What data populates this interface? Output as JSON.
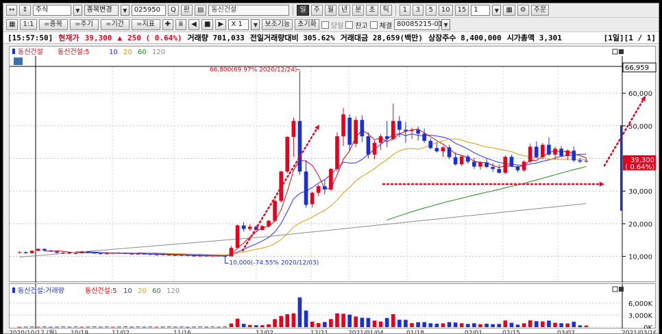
{
  "toolbar": {
    "market_type": "주식",
    "stock_change_label": "종목변경",
    "stock_code": "025950",
    "search_button": "Q",
    "pan_button": "판",
    "stock_name": "동신건설",
    "periods": [
      "일",
      "주",
      "월",
      "년",
      "분",
      "초",
      "틱"
    ],
    "selected_period": "일",
    "intervals": [
      "1",
      "3",
      "5",
      "10",
      "15"
    ],
    "interval_value": "1",
    "order_label": "주문",
    "sub_buttons": [
      "=종목",
      "=주기",
      "=기간",
      "=지표"
    ],
    "multiplier": "X 1",
    "aux_label": "보조기능",
    "reset_label": "초기화",
    "today_label": "당일",
    "balance_label": "잔고",
    "fill_label": "체결",
    "account": "80085215-01"
  },
  "status": {
    "time": "[15:57:50]",
    "current_label": "현재가",
    "price": "39,300",
    "arrow": "▲",
    "change": "250 ( 0.64%)",
    "volume": "거래량 701,033",
    "prev_volume_ratio": "전일거래량대비 305.62%",
    "trade_value": "거래대금 28,659(백만)",
    "shares": "상장주수 8,400,000",
    "market_cap": "시가총액 3,301",
    "page": "[1일][1 / 1]"
  },
  "price_legend": {
    "name": "동신건설",
    "ma_label": "동신건설:5",
    "ma_periods": [
      "10",
      "20",
      "60",
      "120"
    ]
  },
  "volume_legend": {
    "vol_label": "동신건설:거래량",
    "ma_label": "동신건설:5",
    "ma_periods": [
      "10",
      "20",
      "60",
      "120"
    ]
  },
  "annotations": {
    "high": "66,800(69.97% 2020/12/24)",
    "low": "10,000(-74.55% 2020/12/03)",
    "top_value": "66,959",
    "cur_price": "39,300",
    "cur_change": "( 0.64%)"
  },
  "y_ticks": [
    "60,000",
    "50,000",
    "40,000",
    "30,000",
    "20,000",
    "10,000"
  ],
  "vol_ticks": [
    "6,000K",
    "3,000K",
    "0K"
  ],
  "x_ticks": [
    "2020/10/12 (월)",
    "10/19",
    "11/02",
    "11/16",
    "12/02",
    "12/21",
    "2021/01/04",
    "01/18",
    "02/01",
    "02/15",
    "03/02",
    "2021/03/16"
  ],
  "colors": {
    "up": "#e8001c",
    "down": "#1c2fd6",
    "ma5": "#e00000",
    "ma10": "#2a2aff",
    "ma20": "#e89a00",
    "ma60": "#1a8a1a",
    "ma120": "#8a8a8a"
  },
  "chart_data": {
    "type": "candlestick",
    "ylim": [
      3000,
      68000
    ],
    "series": [
      {
        "name": "동신건설",
        "ohlc": [
          [
            11200,
            11600,
            10900,
            11300
          ],
          [
            11300,
            11500,
            10800,
            11000
          ],
          [
            11000,
            11800,
            10900,
            11700
          ],
          [
            11700,
            12500,
            11600,
            12300
          ],
          [
            12300,
            12400,
            11500,
            11800
          ],
          [
            11800,
            12000,
            11300,
            11500
          ],
          [
            11500,
            11600,
            10900,
            11100
          ],
          [
            11100,
            11400,
            10800,
            11200
          ],
          [
            11200,
            11300,
            10700,
            10900
          ],
          [
            10900,
            11200,
            10700,
            11000
          ],
          [
            11000,
            11700,
            10900,
            11500
          ],
          [
            11500,
            11600,
            11000,
            11100
          ],
          [
            11100,
            11300,
            10800,
            10900
          ],
          [
            10900,
            11100,
            10600,
            10800
          ],
          [
            10800,
            11000,
            10600,
            10900
          ],
          [
            10900,
            11200,
            10700,
            11100
          ],
          [
            11100,
            11300,
            10900,
            11000
          ],
          [
            11000,
            11100,
            10700,
            10800
          ],
          [
            10800,
            10900,
            10500,
            10700
          ],
          [
            10700,
            10900,
            10500,
            10800
          ],
          [
            10800,
            11000,
            10600,
            10700
          ],
          [
            10700,
            10800,
            10400,
            10500
          ],
          [
            10500,
            10700,
            10300,
            10600
          ],
          [
            10600,
            10800,
            10400,
            10500
          ],
          [
            10500,
            10600,
            10200,
            10400
          ],
          [
            10400,
            10600,
            10100,
            10300
          ],
          [
            10300,
            10500,
            10100,
            10400
          ],
          [
            10400,
            10500,
            10000,
            10200
          ],
          [
            10200,
            10300,
            10000,
            10100
          ],
          [
            10100,
            10300,
            10000,
            10200
          ],
          [
            10200,
            10400,
            10000,
            10100
          ],
          [
            10100,
            10300,
            10000,
            10200
          ],
          [
            10200,
            10300,
            10000,
            10100
          ],
          [
            10100,
            10200,
            10000,
            10050
          ],
          [
            10000,
            13200,
            10000,
            12600
          ],
          [
            12600,
            19800,
            12400,
            19500
          ],
          [
            19500,
            20500,
            17600,
            18400
          ],
          [
            18400,
            19800,
            17900,
            19100
          ],
          [
            19100,
            19500,
            17800,
            18100
          ],
          [
            18100,
            19600,
            17900,
            19300
          ],
          [
            19300,
            21200,
            18800,
            20900
          ],
          [
            20900,
            27500,
            20500,
            27000
          ],
          [
            27000,
            36200,
            26500,
            36000
          ],
          [
            36000,
            46800,
            35500,
            46600
          ],
          [
            46600,
            52500,
            40500,
            51500
          ],
          [
            51500,
            66800,
            35000,
            36000
          ],
          [
            36000,
            39500,
            25000,
            25800
          ],
          [
            26000,
            29800,
            25000,
            29500
          ],
          [
            29500,
            32000,
            28500,
            31500
          ],
          [
            31500,
            33500,
            29000,
            30500
          ],
          [
            30500,
            37000,
            30000,
            36800
          ],
          [
            36800,
            48000,
            36000,
            46800
          ],
          [
            46800,
            55500,
            43800,
            53500
          ],
          [
            52500,
            53500,
            42500,
            44200
          ],
          [
            44500,
            52800,
            43500,
            51800
          ],
          [
            51800,
            53200,
            45000,
            46800
          ],
          [
            46800,
            48000,
            40000,
            41200
          ],
          [
            41200,
            45500,
            39800,
            44800
          ],
          [
            44800,
            47500,
            42600,
            46800
          ],
          [
            46800,
            51500,
            43500,
            46000
          ],
          [
            46000,
            56800,
            45500,
            51500
          ],
          [
            51500,
            53000,
            46500,
            48800
          ],
          [
            48800,
            51200,
            44800,
            48400
          ],
          [
            48400,
            49500,
            46000,
            48800
          ],
          [
            48800,
            49800,
            45500,
            47600
          ],
          [
            47600,
            49200,
            44800,
            45400
          ],
          [
            45400,
            46200,
            42800,
            43200
          ],
          [
            43200,
            44800,
            41800,
            42200
          ],
          [
            42200,
            43800,
            40500,
            43400
          ],
          [
            43400,
            44200,
            39800,
            40400
          ],
          [
            40400,
            41800,
            37800,
            38200
          ],
          [
            38200,
            41000,
            37600,
            40600
          ],
          [
            40600,
            41200,
            38400,
            39000
          ],
          [
            39000,
            40200,
            36800,
            37500
          ],
          [
            37500,
            39200,
            36600,
            38800
          ],
          [
            38800,
            40000,
            37000,
            37400
          ],
          [
            37400,
            38500,
            35900,
            36800
          ],
          [
            36800,
            38200,
            35400,
            35600
          ],
          [
            35600,
            41000,
            35200,
            40500
          ],
          [
            40500,
            41200,
            37400,
            37600
          ],
          [
            37600,
            38000,
            35800,
            36400
          ],
          [
            36400,
            39400,
            36000,
            39000
          ],
          [
            39000,
            44500,
            38600,
            43600
          ],
          [
            43600,
            45200,
            40000,
            40400
          ],
          [
            40400,
            44800,
            39800,
            44200
          ],
          [
            44200,
            46500,
            40800,
            41200
          ],
          [
            41200,
            43600,
            39800,
            43000
          ],
          [
            43000,
            43800,
            40400,
            40800
          ],
          [
            40800,
            42800,
            39600,
            42400
          ],
          [
            42400,
            43600,
            38900,
            39400
          ],
          [
            39400,
            40200,
            38600,
            39050
          ],
          [
            39050,
            40100,
            38700,
            39300
          ]
        ]
      }
    ]
  }
}
